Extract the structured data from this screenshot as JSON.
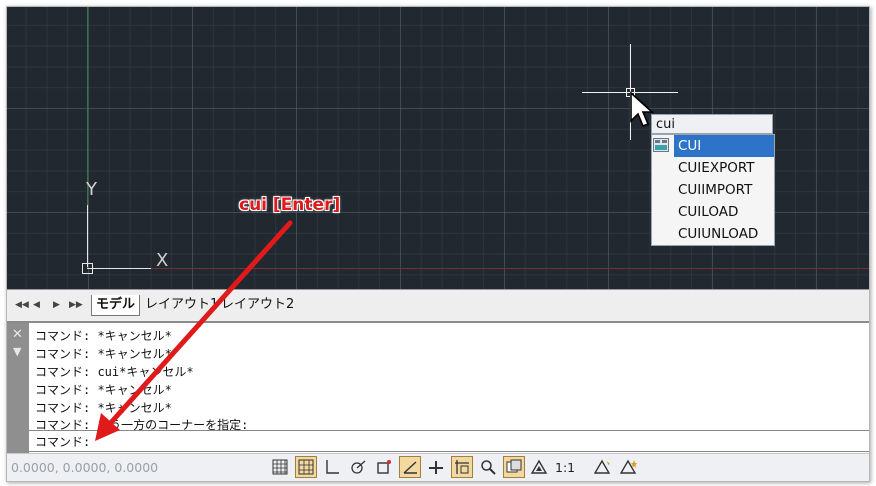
{
  "annotation": {
    "text": "cui [Enter]"
  },
  "canvas": {
    "ucs_y_label": "Y",
    "ucs_x_label": "X"
  },
  "autocomplete": {
    "input_value": "cui",
    "items": [
      "CUI",
      "CUIEXPORT",
      "CUIIMPORT",
      "CUILOAD",
      "CUIUNLOAD"
    ],
    "selected": "CUI"
  },
  "layout_tabs": {
    "nav_icons": [
      "first-icon",
      "prev-icon",
      "next-icon",
      "last-icon"
    ],
    "tabs": [
      "モデル",
      "レイアウト1",
      "レイアウト2"
    ],
    "active": "モデル"
  },
  "command_line": {
    "history": [
      "コマンド: *キャンセル*",
      "コマンド: *キャンセル*",
      "コマンド: cui*キャンセル*",
      "コマンド: *キャンセル*",
      "コマンド: *キャンセル*",
      "コマンド: もう一方のコーナーを指定:"
    ],
    "prompt": "コマンド:"
  },
  "status_bar": {
    "coordinates": "0.0000, 0.0000, 0.0000",
    "scale": "1:1",
    "icons": [
      "model-space-icon",
      "grid-icon",
      "ortho-icon",
      "polar-icon",
      "object-snap-icon",
      "isodraft-icon",
      "lineweight-icon",
      "quick-props-icon",
      "zoom-icon",
      "viewport-icon",
      "annotation-scale-icon",
      "annotation-visibility-icon",
      "auto-scale-icon"
    ]
  },
  "colors": {
    "canvas_bg": "#212830",
    "accent_red": "#e01a1a",
    "selection_blue": "#2d73c8"
  }
}
